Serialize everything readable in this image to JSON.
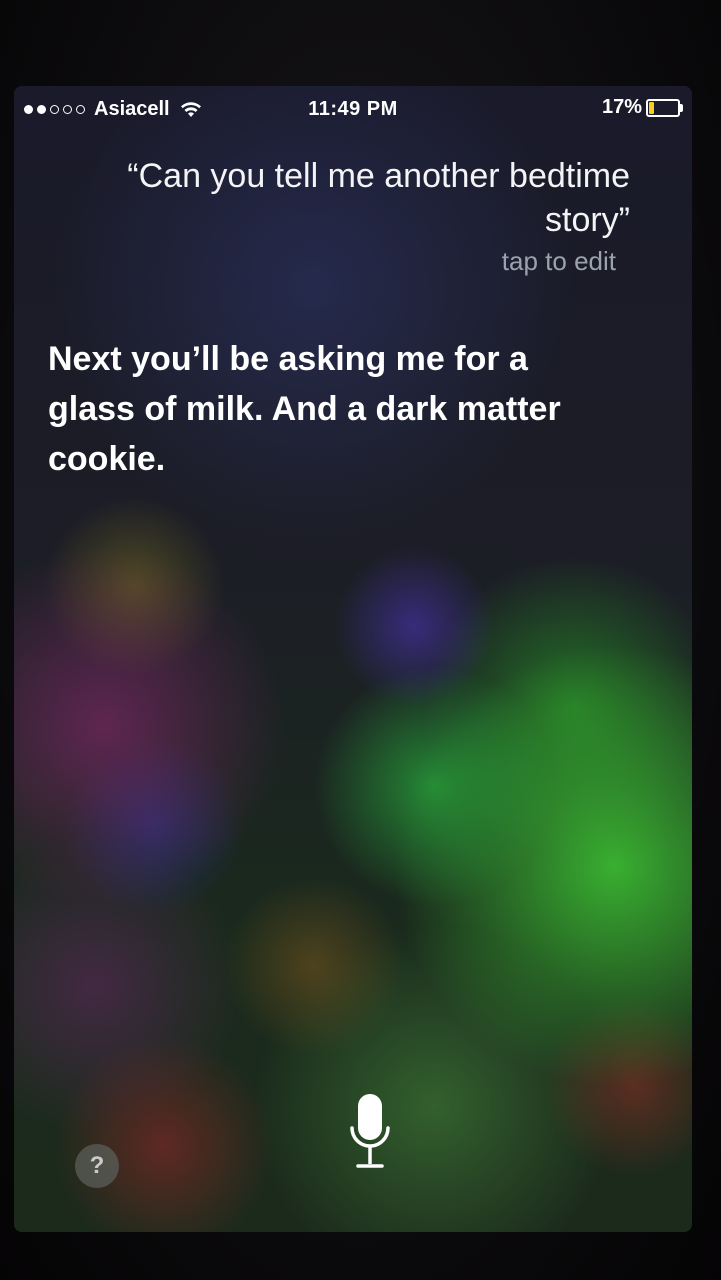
{
  "status_bar": {
    "carrier": "Asiacell",
    "signal_bars_filled": 2,
    "signal_bars_total": 5,
    "time": "11:49 PM",
    "battery_percent": "17%",
    "battery_level": 0.17,
    "battery_color": "#f5d020",
    "icons": [
      "wifi-icon",
      "battery-icon"
    ]
  },
  "siri": {
    "query": "“Can you tell me another bedtime story”",
    "tap_to_edit": "tap to edit",
    "response": "Next you’ll be asking me for a glass of milk. And a dark matter cookie.",
    "help_label": "?",
    "mic_icon": "microphone-icon"
  }
}
